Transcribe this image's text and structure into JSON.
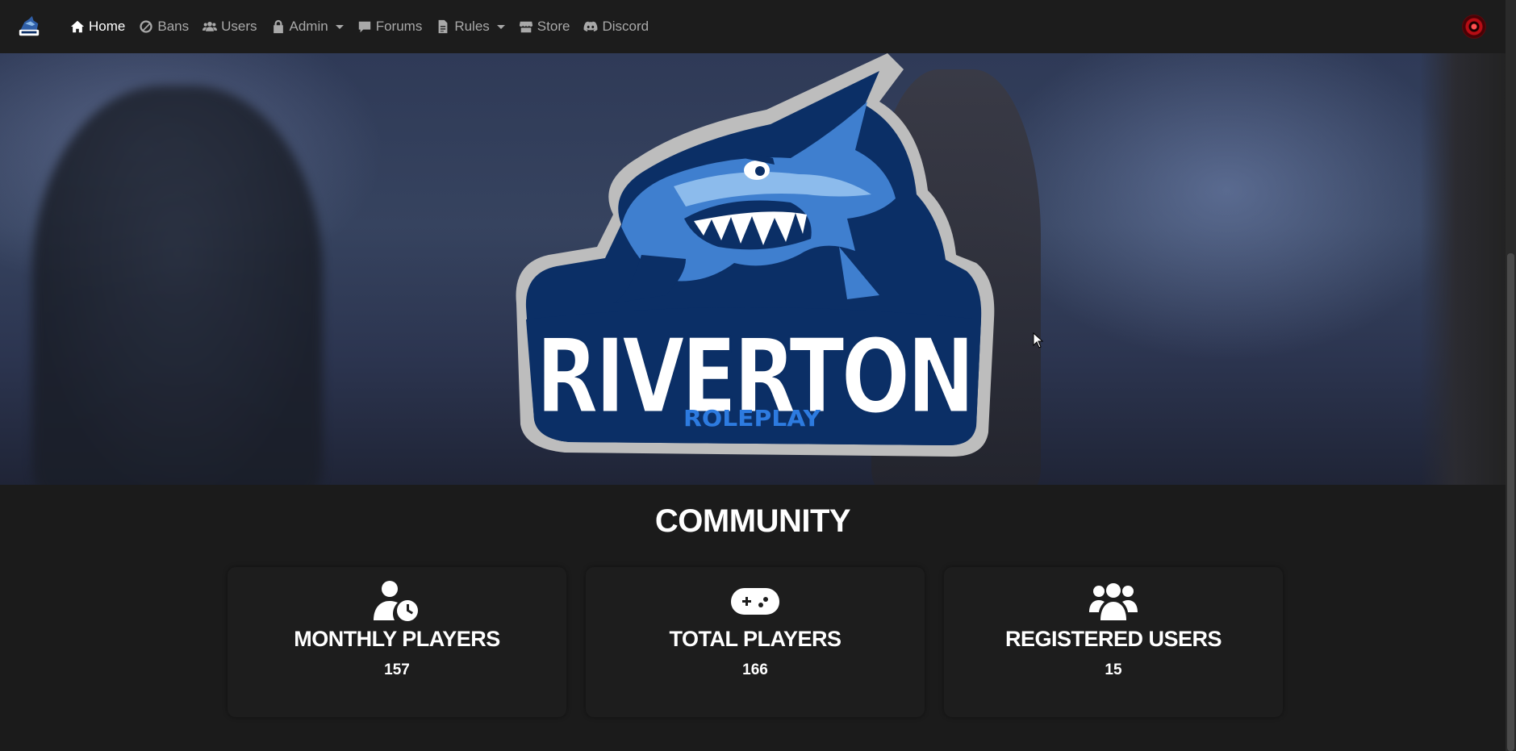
{
  "nav": {
    "brand_icon": "riverton-logo-icon",
    "items": [
      {
        "label": "Home",
        "icon": "home-icon",
        "active": true
      },
      {
        "label": "Bans",
        "icon": "ban-icon"
      },
      {
        "label": "Users",
        "icon": "users-icon"
      },
      {
        "label": "Admin",
        "icon": "lock-icon",
        "dropdown": true
      },
      {
        "label": "Forums",
        "icon": "comment-icon"
      },
      {
        "label": "Rules",
        "icon": "file-icon",
        "dropdown": true
      },
      {
        "label": "Store",
        "icon": "store-icon"
      },
      {
        "label": "Discord",
        "icon": "discord-icon"
      }
    ],
    "avatar_icon": "user-avatar"
  },
  "hero": {
    "logo_title": "RIVERTON",
    "logo_subtitle": "ROLEPLAY"
  },
  "community": {
    "title": "COMMUNITY",
    "cards": [
      {
        "icon": "user-clock-icon",
        "title": "MONTHLY PLAYERS",
        "value": "157"
      },
      {
        "icon": "gamepad-icon",
        "title": "TOTAL PLAYERS",
        "value": "166"
      },
      {
        "icon": "users-icon",
        "title": "REGISTERED USERS",
        "value": "15"
      }
    ]
  },
  "colors": {
    "background": "#1b1b1b",
    "navbar": "#1c1c1c",
    "card": "#1d1d1d",
    "logo_navy": "#0b2f66",
    "logo_blue": "#3b7fd6",
    "logo_light_blue": "#7fb2e8"
  }
}
